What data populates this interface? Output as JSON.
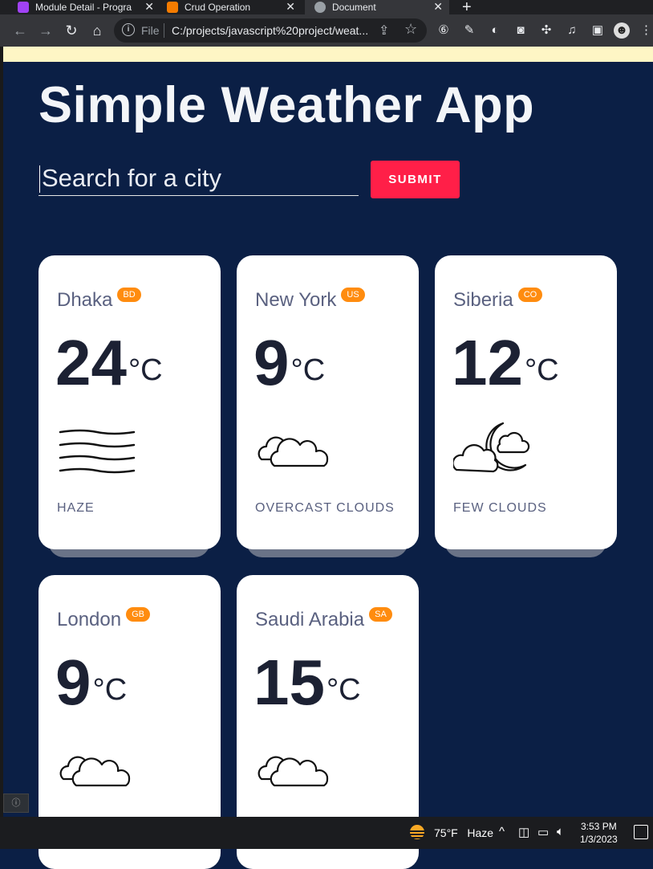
{
  "browser": {
    "tabs": [
      {
        "title": "Module Detail - Progra",
        "color": "#a142f4"
      },
      {
        "title": "Crud Operation",
        "color": "#f57c00"
      },
      {
        "title": "Document",
        "color": "#9aa0a6"
      }
    ],
    "address": {
      "scheme_label": "File",
      "url": "C:/projects/javascript%20project/weat..."
    }
  },
  "app": {
    "title": "Simple Weather App",
    "search": {
      "placeholder": "Search for a city",
      "value": ""
    },
    "submit_label": "SUBMIT",
    "cards": [
      {
        "city": "Dhaka",
        "country": "BD",
        "temp": "24",
        "unit": "°C",
        "description": "HAZE",
        "icon": "haze-icon"
      },
      {
        "city": "New York",
        "country": "US",
        "temp": "9",
        "unit": "°C",
        "description": "OVERCAST CLOUDS",
        "icon": "overcast-clouds-icon"
      },
      {
        "city": "Siberia",
        "country": "CO",
        "temp": "12",
        "unit": "°C",
        "description": "FEW CLOUDS",
        "icon": "few-clouds-night-icon"
      },
      {
        "city": "London",
        "country": "GB",
        "temp": "9",
        "unit": "°C",
        "description": "",
        "icon": "overcast-clouds-icon"
      },
      {
        "city": "Saudi Arabia",
        "country": "SA",
        "temp": "15",
        "unit": "°C",
        "description": "",
        "icon": "overcast-clouds-icon"
      }
    ],
    "colors": {
      "background": "#0b1f45",
      "accent": "#ff1f48",
      "badge": "#ff8c0f"
    }
  },
  "taskbar": {
    "weather_temp": "75°F",
    "weather_desc": "Haze",
    "time": "3:53 PM",
    "date": "1/3/2023"
  }
}
